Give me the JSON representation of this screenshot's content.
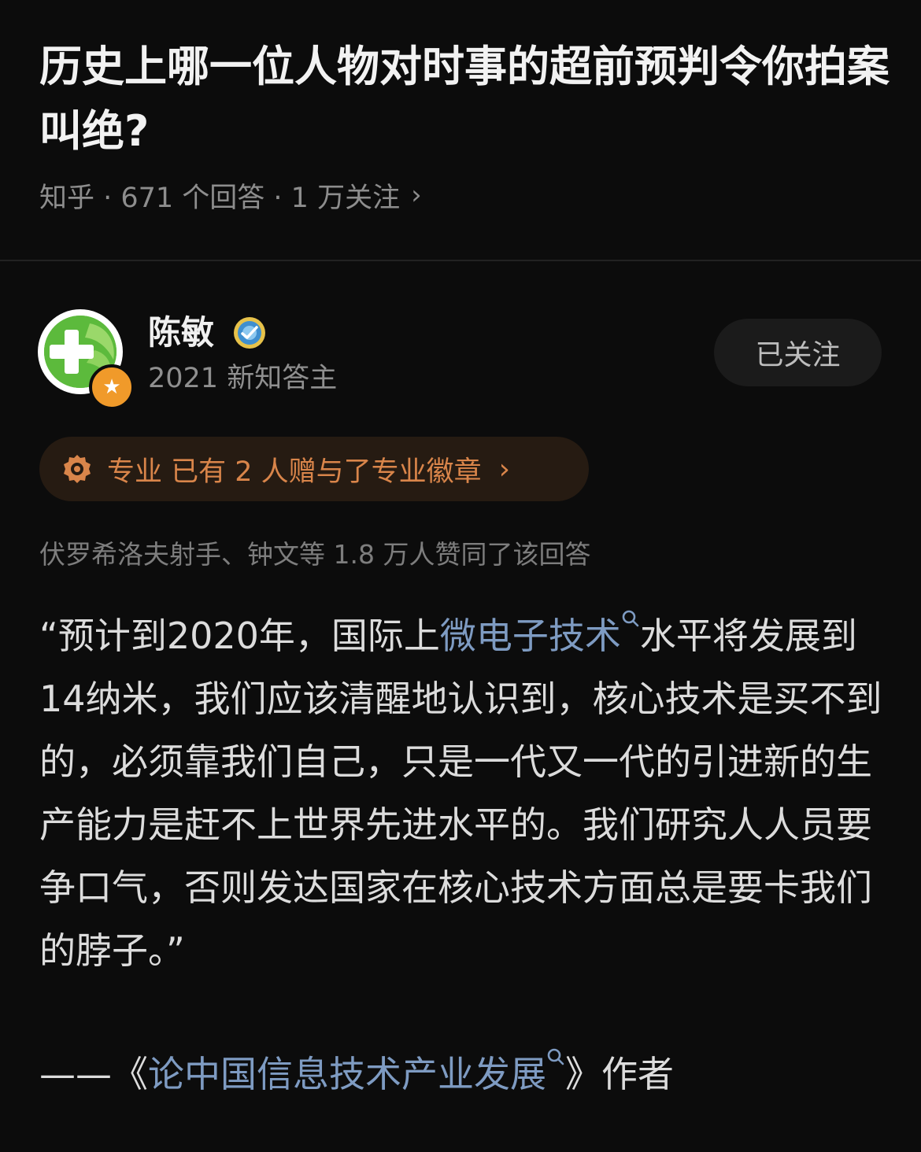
{
  "question": {
    "title": "历史上哪一位人物对时事的超前预判令你拍案叫绝?",
    "meta": "知乎 · 671 个回答 · 1 万关注",
    "meta_chevron": "›"
  },
  "author": {
    "name": "陈敏",
    "subtitle": "2021 新知答主",
    "follow_label": "已关注",
    "avatar_badge": "★",
    "avatar_color": "#59b83a"
  },
  "badge_pill": {
    "text": "专业 已有 2 人赠与了专业徽章",
    "chevron": "›",
    "color": "#d9854a"
  },
  "votes_line": "伏罗希洛夫射手、钟文等 1.8 万人赞同了该回答",
  "answer": {
    "part1": "“预计到2020年，国际上",
    "link1": "微电子技术",
    "part2": "水平将发展到14纳米，我们应该清醒地认识到，核心技术是买不到的，必须靠我们自己，只是一代又一代的引进新的生产能力是赶不上世界先进水平的。我们研究人人员要争口气，否则发达国家在核心技术方面总是要卡我们的脖子。”",
    "footer_prefix": "——《",
    "link2": "论中国信息技术产业发展",
    "footer_suffix": "》作者",
    "link_color": "#7e9bc2"
  }
}
